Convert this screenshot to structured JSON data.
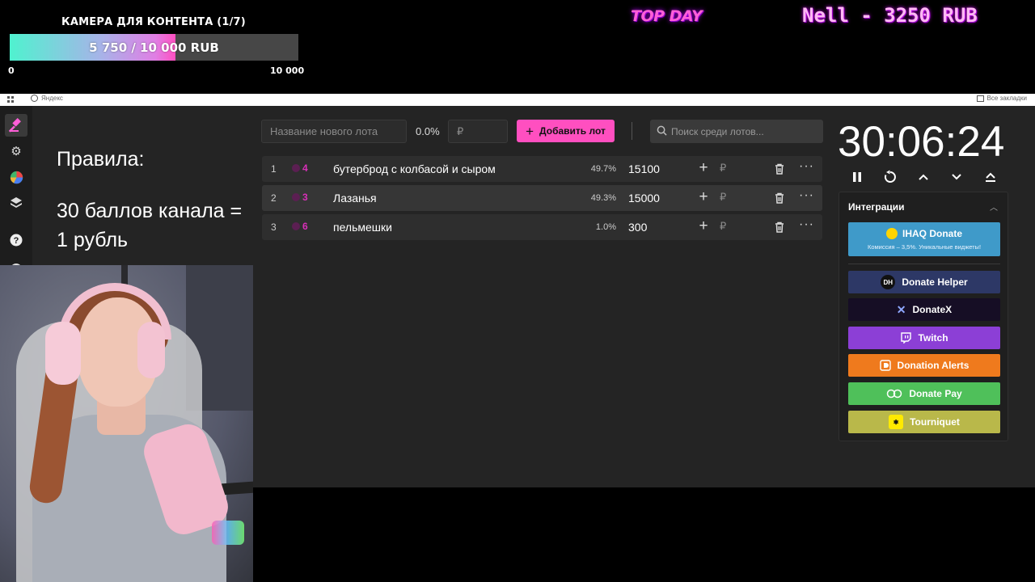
{
  "overlay": {
    "goal_title": "КАМЕРА ДЛЯ КОНТЕНТА (1/7)",
    "goal_text": "5 750 / 10 000 RUB",
    "goal_progress": 0.575,
    "goal_min": "0",
    "goal_max": "10 000",
    "top_day": "TOP DAY",
    "top_donor": "Nell - 3250 RUB"
  },
  "browser": {
    "yandex_label": "Яндекс",
    "bookmarks_label": "Все закладки"
  },
  "sidebar": {
    "items": [
      {
        "icon": "gavel-icon",
        "active": true
      },
      {
        "icon": "gear-icon"
      },
      {
        "icon": "pie-chart-icon"
      },
      {
        "icon": "layers-icon"
      },
      {
        "icon": "help-icon"
      },
      {
        "icon": "umbrella-icon"
      }
    ]
  },
  "rules": {
    "title": "Правила:",
    "text": "30 баллов канала = 1 рубль"
  },
  "toolbar": {
    "new_lot_placeholder": "Название нового лота",
    "percent": "0.0%",
    "amount_placeholder": "₽",
    "add_label": "Добавить лот",
    "search_placeholder": "Поиск среди лотов..."
  },
  "lots": [
    {
      "index": "1",
      "votes": "4",
      "name": "бутерброд с колбасой и сыром",
      "percent": "49.7%",
      "amount": "15100"
    },
    {
      "index": "2",
      "votes": "3",
      "name": "Лазанья",
      "percent": "49.3%",
      "amount": "15000"
    },
    {
      "index": "3",
      "votes": "6",
      "name": "пельмешки",
      "percent": "1.0%",
      "amount": "300"
    }
  ],
  "lot_actions": {
    "rub_symbol": "₽",
    "more": "···"
  },
  "timer": {
    "value": "30:06:24"
  },
  "integrations": {
    "title": "Интеграции",
    "ihaq": {
      "label": "IHAQ Donate",
      "subtitle": "Комиссия – 3,5%. Уникальные виджеты!",
      "color": "#3f9ac9"
    },
    "buttons": [
      {
        "label": "Donate Helper",
        "color": "#2d3866",
        "icon": "donate-helper-icon"
      },
      {
        "label": "DonateX",
        "color": "#160e25",
        "icon": "donatex-icon"
      },
      {
        "label": "Twitch",
        "color": "#8c3fd6",
        "icon": "twitch-icon"
      },
      {
        "label": "Donation Alerts",
        "color": "#ef7a1d",
        "icon": "donationalerts-icon"
      },
      {
        "label": "Donate Pay",
        "color": "#4fc05a",
        "icon": "donatepay-icon"
      },
      {
        "label": "Tourniquet",
        "color": "#b9b84a",
        "icon": "tourniquet-icon"
      }
    ]
  },
  "colors": {
    "accent": "#ff4fc0",
    "panel_bg": "#242424",
    "row_bg": "#2e2e2e"
  }
}
